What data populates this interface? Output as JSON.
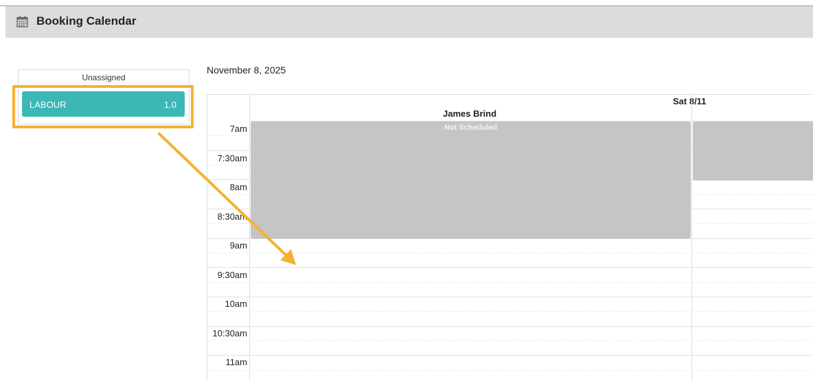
{
  "header": {
    "title": "Booking Calendar",
    "icon": "calendar-icon"
  },
  "unassigned": {
    "title": "Unassigned",
    "items": [
      {
        "name": "LABOUR",
        "hours": "1.0",
        "color": "#3bb7b6"
      }
    ]
  },
  "calendar": {
    "date": "November 8, 2025",
    "day_header": "Sat 8/11",
    "resource": "James Brind",
    "times": [
      "7am",
      "7:30am",
      "8am",
      "8:30am",
      "9am",
      "9:30am",
      "10am",
      "10:30am",
      "11am"
    ],
    "blocks": [
      {
        "label": "Not Scheduled",
        "color": "#c4c5c4"
      }
    ]
  },
  "annotation": {
    "highlight_color": "#f2b233"
  }
}
